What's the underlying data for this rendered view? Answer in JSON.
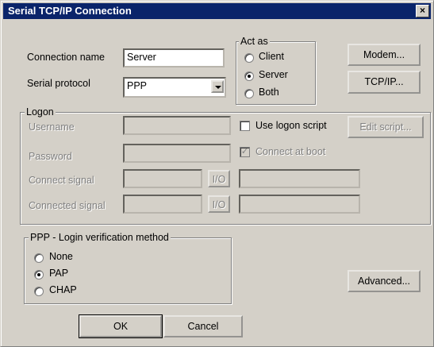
{
  "window": {
    "title": "Serial TCP/IP Connection",
    "close_glyph": "×"
  },
  "connection": {
    "label": "Connection name",
    "value": "Server"
  },
  "protocol": {
    "label": "Serial protocol",
    "value": "PPP"
  },
  "act_as": {
    "legend": "Act as",
    "options": [
      "Client",
      "Server",
      "Both"
    ],
    "selected": "Server"
  },
  "buttons": {
    "modem": "Modem...",
    "tcpip": "TCP/IP...",
    "edit_script": "Edit script...",
    "advanced": "Advanced...",
    "ok": "OK",
    "cancel": "Cancel"
  },
  "logon": {
    "legend": "Logon",
    "username_label": "Username",
    "password_label": "Password",
    "connect_signal_label": "Connect signal",
    "connected_signal_label": "Connected signal",
    "io_label": "I/O",
    "use_logon_script": "Use logon script",
    "connect_at_boot": "Connect at boot",
    "connect_at_boot_checked": true,
    "use_logon_script_checked": false
  },
  "ppp": {
    "legend": "PPP - Login verification method",
    "options": [
      "None",
      "PAP",
      "CHAP"
    ],
    "selected": "PAP"
  },
  "colors": {
    "titlebar": "#0a246a",
    "face": "#d4d0c8",
    "disabled_text": "#808080"
  },
  "icons": {
    "close": "close-icon",
    "dropdown": "chevron-down-icon"
  }
}
